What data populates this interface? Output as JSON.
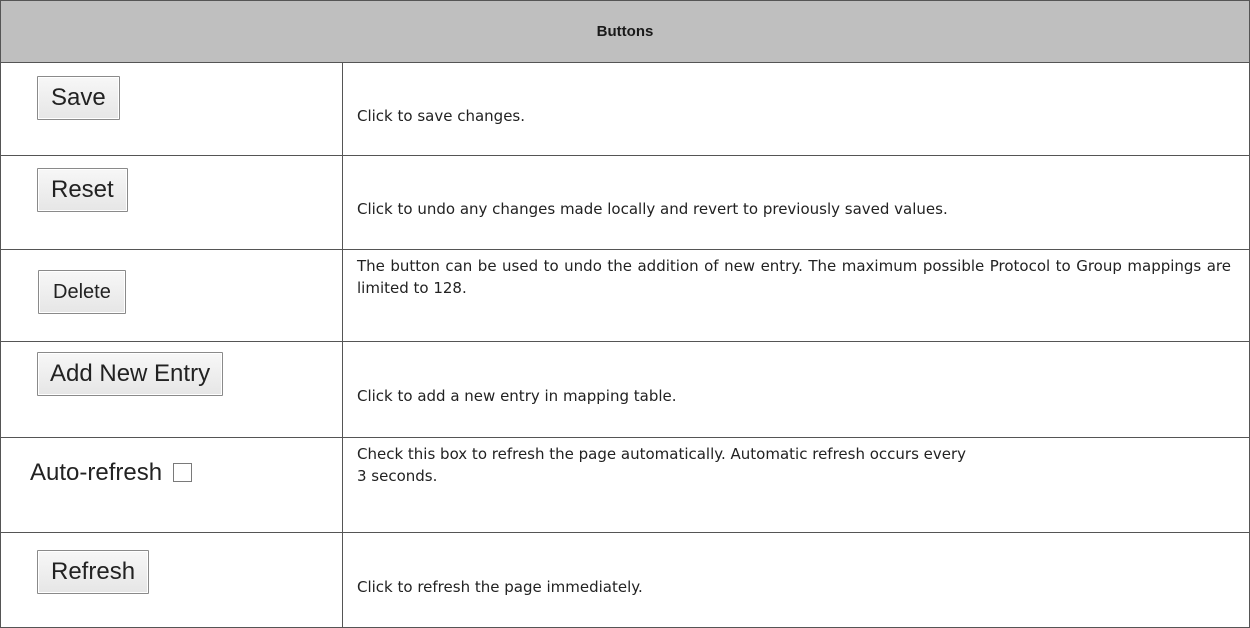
{
  "table": {
    "header": "Buttons",
    "rows": [
      {
        "control_label": "Save",
        "description": "Click to save changes."
      },
      {
        "control_label": "Reset",
        "description": "Click to undo any changes made locally and revert to previously saved values."
      },
      {
        "control_label": "Delete",
        "description": "The button can be used to undo the addition of new entry. The maximum possible Protocol to Group mappings are limited to 128."
      },
      {
        "control_label": "Add New Entry",
        "description": "Click to add a new entry in mapping table."
      },
      {
        "control_label": "Auto-refresh",
        "description": "Check this box to refresh the page automatically. Automatic refresh occurs every 3 seconds.",
        "checked": false
      },
      {
        "control_label": "Refresh",
        "description": "Click to refresh the page immediately."
      }
    ]
  }
}
